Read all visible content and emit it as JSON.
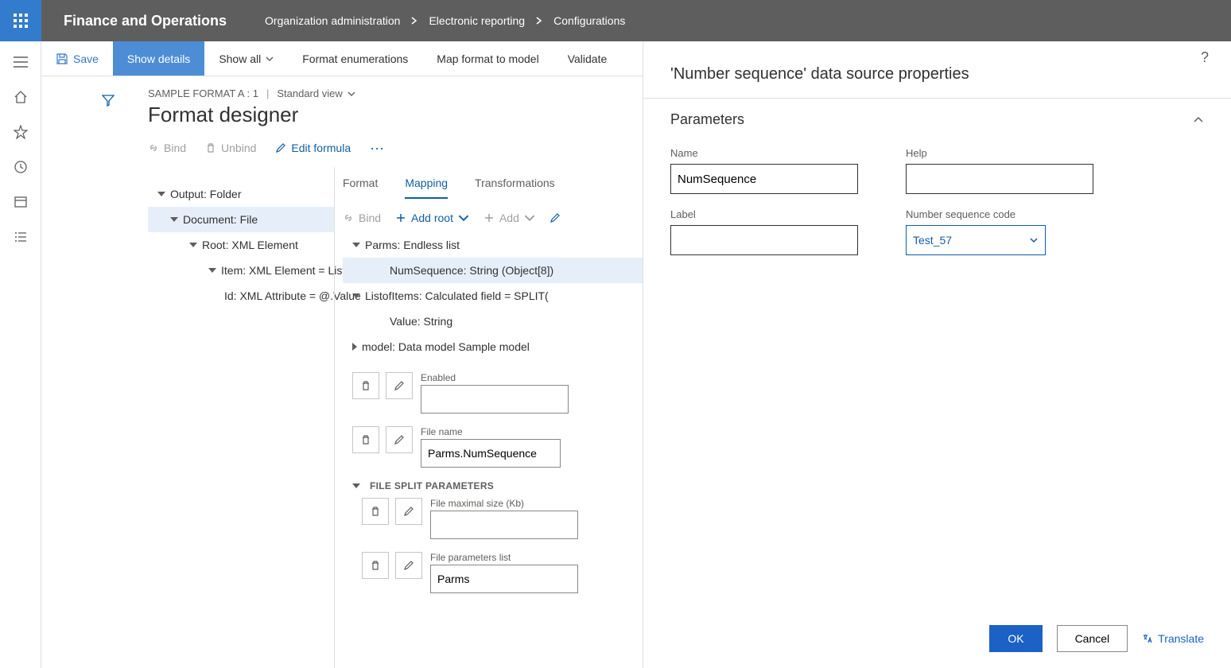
{
  "topbar": {
    "app_title": "Finance and Operations",
    "breadcrumb": [
      "Organization administration",
      "Electronic reporting",
      "Configurations"
    ]
  },
  "cmdbar": {
    "save": "Save",
    "show_details": "Show details",
    "show_all": "Show all",
    "format_enum": "Format enumerations",
    "map_format": "Map format to model",
    "validate": "Validate"
  },
  "pagehead": {
    "crumb": "SAMPLE FORMAT A : 1",
    "view": "Standard view",
    "title": "Format designer"
  },
  "subtoolbar": {
    "bind": "Bind",
    "unbind": "Unbind",
    "edit_formula": "Edit formula"
  },
  "tabs": {
    "format": "Format",
    "mapping": "Mapping",
    "transformations": "Transformations"
  },
  "maptoolbar": {
    "bind": "Bind",
    "add_root": "Add root",
    "add": "Add"
  },
  "left_tree": {
    "n0": "Output: Folder",
    "n1": "Document: File",
    "n2": "Root: XML Element",
    "n3": "Item: XML Element = ListofItems",
    "n4": "Id: XML Attribute = @.Value"
  },
  "right_tree": {
    "n0": "Parms: Endless list",
    "n1": "NumSequence: String (Object[8])",
    "n2": "ListofItems: Calculated field = SPLIT(",
    "n3": "Value: String",
    "n4": "model: Data model Sample model"
  },
  "props": {
    "enabled_label": "Enabled",
    "enabled_value": "",
    "filename_label": "File name",
    "filename_value": "Parms.NumSequence",
    "split_section": "FILE SPLIT PARAMETERS",
    "maxsize_label": "File maximal size (Kb)",
    "maxsize_value": "",
    "paramslist_label": "File parameters list",
    "paramslist_value": "Parms"
  },
  "sidepanel": {
    "title": "'Number sequence' data source properties",
    "section": "Parameters",
    "name_label": "Name",
    "name_value": "NumSequence",
    "label_label": "Label",
    "label_value": "",
    "help_label": "Help",
    "help_value": "",
    "seq_label": "Number sequence code",
    "seq_value": "Test_57",
    "ok": "OK",
    "cancel": "Cancel",
    "translate": "Translate"
  }
}
